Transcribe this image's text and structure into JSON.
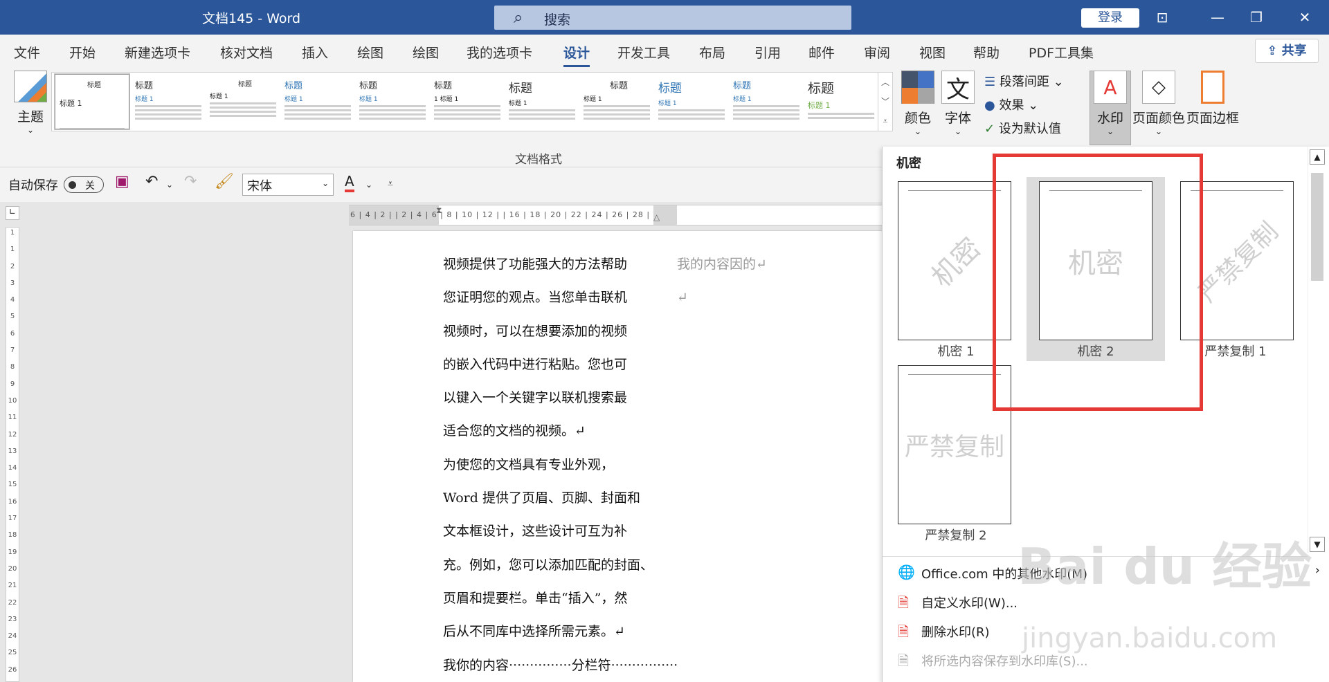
{
  "titlebar": {
    "title": "文档145  -  Word",
    "search_label": "搜索",
    "login": "登录"
  },
  "tabs": [
    "文件",
    "开始",
    "新建选项卡",
    "核对文档",
    "插入",
    "绘图",
    "绘图",
    "我的选项卡",
    "设计",
    "开发工具",
    "布局",
    "引用",
    "邮件",
    "审阅",
    "视图",
    "帮助",
    "PDF工具集"
  ],
  "active_tab": "设计",
  "share": "共享",
  "ribbon": {
    "theme_label": "主题",
    "gallery": [
      {
        "heading": "标题",
        "sub": "标题 1",
        "selected": true
      },
      {
        "heading": "标题",
        "sub": "标题 1"
      },
      {
        "heading": "标题",
        "sub": "标题 1"
      },
      {
        "heading": "标题",
        "sub": "标题 1"
      },
      {
        "heading": "标题",
        "sub": "标题 1"
      },
      {
        "heading": "标题",
        "sub": "1  标题 1"
      },
      {
        "heading": "标题",
        "sub": "标题 1"
      },
      {
        "heading": "标题",
        "sub": "标题 1"
      },
      {
        "heading": "标题",
        "sub": "标题 1"
      },
      {
        "heading": "标题",
        "sub": "标题 1"
      },
      {
        "heading": "标题",
        "sub": "标题 1"
      }
    ],
    "colors_label": "颜色",
    "fonts_label": "字体",
    "paragraph_spacing": "段落间距",
    "effects": "效果",
    "set_default": "设为默认值",
    "watermark": "水印",
    "page_color": "页面颜色",
    "page_borders": "页面边框",
    "group_label": "文档格式"
  },
  "qat": {
    "autosave": "自动保存",
    "toggle": "关",
    "font": "宋体"
  },
  "ruler": "6 | 4 | 2 |   | 2 | 4 | 6 | 8 | 10 | 12 |   | 16 | 18 | 20 | 22 | 24 | 26 | 28 |",
  "vruler": [
    "1",
    "1",
    "2",
    "3",
    "4",
    "5",
    "6",
    "7",
    "8",
    "9",
    "10",
    "11",
    "12",
    "13",
    "14",
    "15",
    "16",
    "17",
    "18",
    "19",
    "20",
    "21",
    "22",
    "23",
    "24",
    "25",
    "26"
  ],
  "document": {
    "col1": [
      "视频提供了功能强大的方法帮助",
      "您证明您的观点。当您单击联机",
      "视频时，可以在想要添加的视频",
      "的嵌入代码中进行粘贴。您也可",
      "以键入一个关键字以联机搜索最",
      "适合您的文档的视频。↵",
      "为使您的文档具有专业外观，",
      "Word 提供了页眉、页脚、封面和",
      "文本框设计，这些设计可互为补",
      "充。例如，您可以添加匹配的封面、",
      "页眉和提要栏。单击“插入”，然",
      "后从不同库中选择所需元素。↵",
      "我你的内容···············分栏符················"
    ],
    "col2": [
      "我的内容因的↵",
      "↵"
    ]
  },
  "panel": {
    "section": "机密",
    "items": [
      {
        "label": "机密 1",
        "text": "机密"
      },
      {
        "label": "机密 2",
        "text": "机密",
        "selected": true
      },
      {
        "label": "严禁复制 1",
        "text": "严禁复制"
      },
      {
        "label": "严禁复制 2",
        "text": "严禁复制"
      }
    ],
    "menu": [
      {
        "label": "Office.com 中的其他水印(M)",
        "icon": "globe-icon"
      },
      {
        "label": "自定义水印(W)...",
        "icon": "custom-watermark-icon"
      },
      {
        "label": "删除水印(R)",
        "icon": "remove-watermark-icon"
      },
      {
        "label": "将所选内容保存到水印库(S)...",
        "icon": "save-gallery-icon",
        "disabled": true
      }
    ]
  },
  "overlay": {
    "brand": "Bai du 经验",
    "url": "jingyan.baidu.com"
  }
}
